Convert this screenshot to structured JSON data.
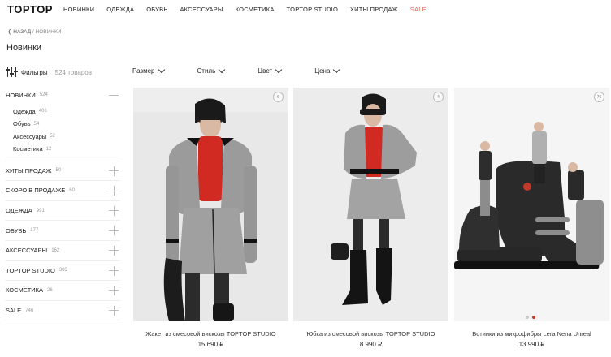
{
  "brand": {
    "logo": "TOPTOP"
  },
  "nav": [
    "НОВИНКИ",
    "ОДЕЖДА",
    "ОБУВЬ",
    "АКСЕССУАРЫ",
    "КОСМЕТИКА",
    "TOPTOP STUDIO",
    "ХИТЫ ПРОДАЖ",
    "SALE"
  ],
  "breadcrumb": {
    "back": "НАЗАД",
    "current": "НОВИНКИ"
  },
  "page": {
    "title": "Новинки"
  },
  "filters": {
    "label": "Фильтры",
    "count": "524 товаров"
  },
  "dropdowns": [
    "Размер",
    "Стиль",
    "Цвет",
    "Цена"
  ],
  "categories": [
    {
      "label": "НОВИНКИ",
      "count": "524",
      "open": true,
      "sub": [
        {
          "label": "Одежда",
          "count": "406"
        },
        {
          "label": "Обувь",
          "count": "54"
        },
        {
          "label": "Аксессуары",
          "count": "52"
        },
        {
          "label": "Косметика",
          "count": "12"
        }
      ]
    },
    {
      "label": "ХИТЫ ПРОДАЖ",
      "count": "50"
    },
    {
      "label": "СКОРО В ПРОДАЖЕ",
      "count": "60"
    },
    {
      "label": "ОДЕЖДА",
      "count": "991"
    },
    {
      "label": "ОБУВЬ",
      "count": "177"
    },
    {
      "label": "АКСЕССУАРЫ",
      "count": "162"
    },
    {
      "label": "TOPTOP STUDIO",
      "count": "383"
    },
    {
      "label": "КОСМЕТИКА",
      "count": "26"
    },
    {
      "label": "SALE",
      "count": "746"
    }
  ],
  "products": [
    {
      "name": "Жакет из смесовой вискозы TOPTOP STUDIO",
      "price": "15 690 ₽",
      "likes": "6"
    },
    {
      "name": "Юбка из смесовой вискозы TOPTOP STUDIO",
      "price": "8 990 ₽",
      "likes": "4"
    },
    {
      "name": "Ботинки из микрофибры Lera Nena Unreal",
      "price": "13 990 ₽",
      "likes": "76"
    }
  ],
  "colors": {
    "sale": "#e0625a",
    "text": "#222222",
    "muted": "#999999"
  }
}
